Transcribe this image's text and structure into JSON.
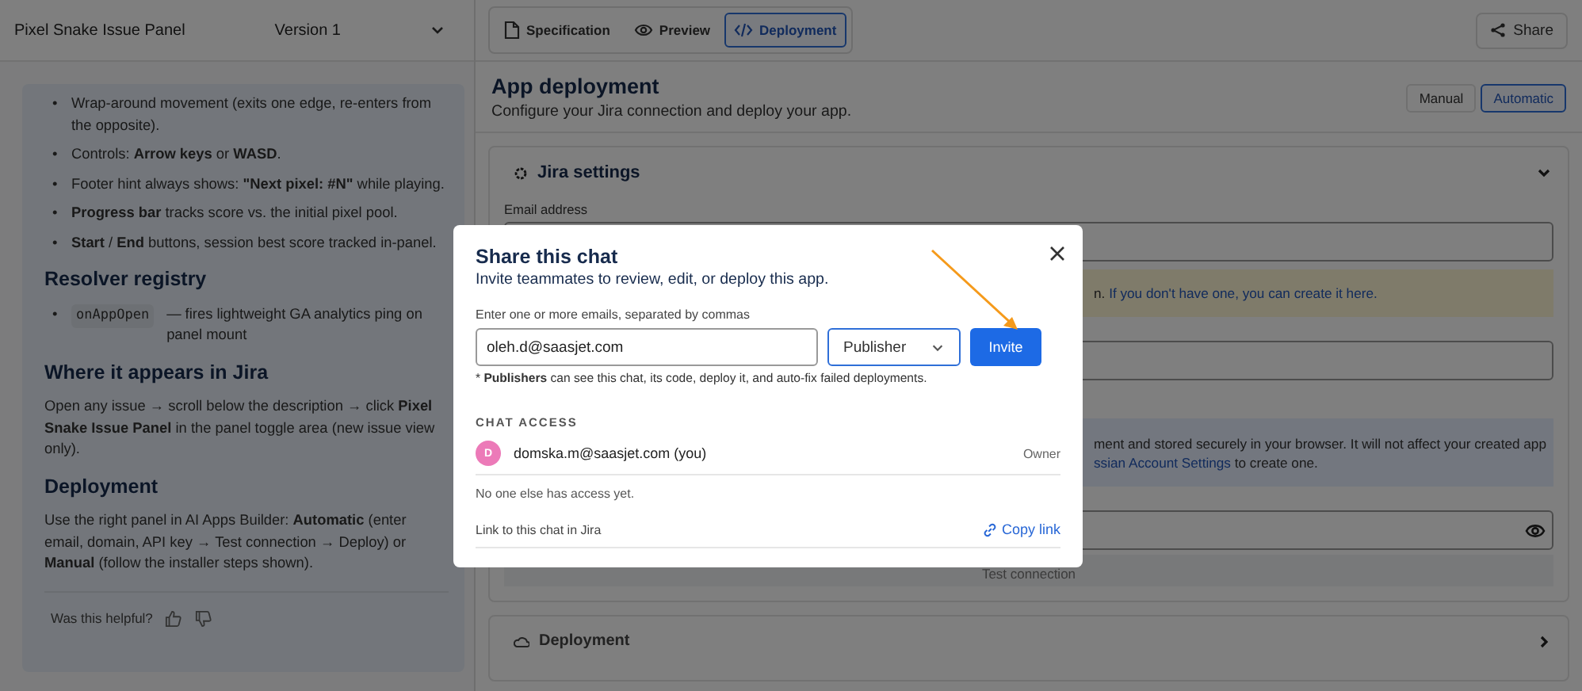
{
  "left_panel": {
    "title": "Pixel Snake Issue Panel",
    "version_select": "Version 1",
    "bullets": [
      {
        "marker": "•",
        "text": "Wrap-around movement (exits one edge, re-enters from the opposite)."
      },
      {
        "marker": "•",
        "text": "Controls: **Arrow keys** or **WASD**."
      },
      {
        "marker": "•",
        "text": "Footer hint always shows: **\"Next pixel: #N\"** while playing."
      },
      {
        "marker": "•",
        "text": "**Progress bar** tracks score vs. the initial pixel pool."
      },
      {
        "marker": "•",
        "text": "**Start** / **End** buttons, session best score tracked in-panel."
      }
    ],
    "sections": [
      {
        "heading": "Resolver registry",
        "items": [
          {
            "marker": "•",
            "code": "onAppOpen",
            "text": "— fires lightweight GA analytics ping on panel mount"
          }
        ]
      },
      {
        "heading": "Where it appears in Jira",
        "paragraph": "Open any issue → scroll below the description → click **Pixel Snake Issue Panel** in the panel toggle area (new issue view only)."
      },
      {
        "heading": "Deployment",
        "paragraph": "Use the right panel in AI Apps Builder: **Automatic** (enter email, domain, API key → Test connection → Deploy) or **Manual** (follow the installer steps shown)."
      }
    ],
    "feedback": "Was this helpful?"
  },
  "tabs": [
    {
      "label": "Specification",
      "selected": false
    },
    {
      "label": "Preview",
      "selected": false
    },
    {
      "label": "Deployment",
      "selected": true
    }
  ],
  "share_button": "Share",
  "deployment": {
    "title": "App deployment",
    "subtitle": "Configure your Jira connection and deploy your app.",
    "modes": [
      {
        "label": "Manual",
        "selected": false
      },
      {
        "label": "Automatic",
        "selected": true
      }
    ],
    "jira_settings": {
      "title": "Jira settings",
      "expanded": true,
      "email_label": "Email address",
      "warning_text": "n.",
      "warning_link": "If you don't have one, you can create it here.",
      "info_line": "ment and stored securely in your browser. It will not affect your created app",
      "info_link": "ssian Account Settings",
      "info_rest": " to create one.",
      "test_button": "Test connection"
    },
    "deploy_section": {
      "title": "Deployment",
      "expanded": false
    }
  },
  "modal": {
    "title": "Share this chat",
    "subtitle": "Invite teammates to review, edit, or deploy this app.",
    "email_label": "Enter one or more emails, separated by commas",
    "email_value": "oleh.d@saasjet.com",
    "role": "Publisher",
    "invite_button": "Invite",
    "note": "* **Publishers** can see this chat, its code, deploy it, and auto-fix failed deployments.",
    "access_heading": "CHAT ACCESS",
    "members": [
      {
        "initial": "D",
        "email": "domska.m@saasjet.com (you)",
        "role": "Owner",
        "color": "#ec7ab8"
      }
    ],
    "empty_note": "No one else has access yet.",
    "link_label": "Link to this chat in Jira",
    "copy_link": "Copy link"
  }
}
